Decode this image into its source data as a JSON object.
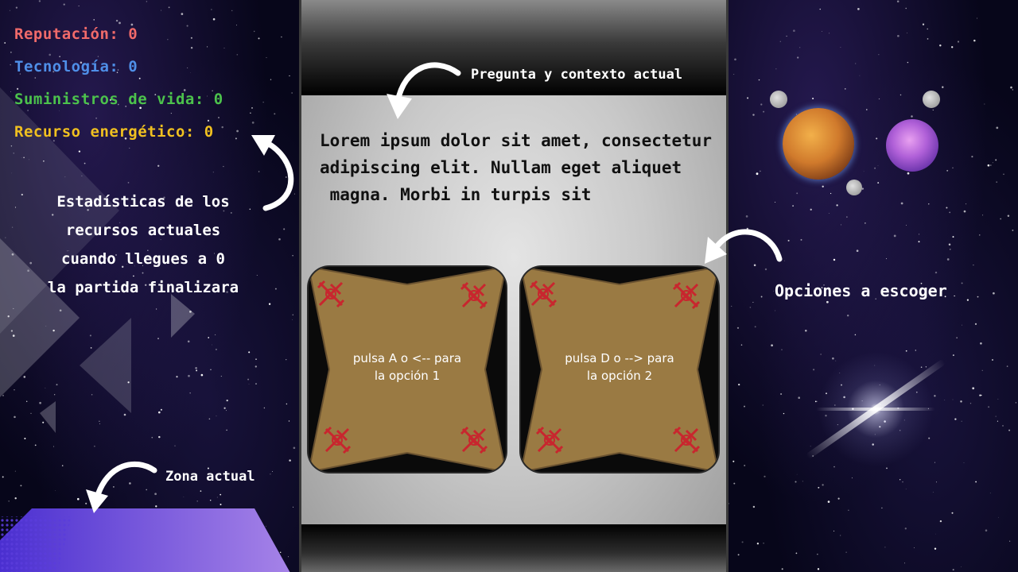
{
  "stats": {
    "reputation": {
      "label": "Reputación: 0",
      "color": "#f06a6a"
    },
    "technology": {
      "label": "Tecnología: 0",
      "color": "#4f8fe8"
    },
    "supplies": {
      "label": "Suministros de vida: 0",
      "color": "#4cc24c"
    },
    "energy": {
      "label": "Recurso energético: 0",
      "color": "#f0c020"
    }
  },
  "annotations": {
    "stats_note": [
      "Estadísticas de los",
      "recursos actuales",
      "cuando llegues a 0",
      "la partida finalizara"
    ],
    "question_note": "Pregunta y contexto actual",
    "options_note": "Opciones a escoger",
    "zone_note": "Zona actual"
  },
  "question": {
    "lines": [
      "Lorem ipsum dolor sit amet, consectetur",
      "adipiscing elit. Nullam eget aliquet",
      " magna. Morbi in turpis sit"
    ]
  },
  "options": [
    {
      "lines": [
        "pulsa A o <-- para",
        "la opción 1"
      ]
    },
    {
      "lines": [
        "pulsa D o --> para",
        "la opción 2"
      ]
    }
  ],
  "colors": {
    "card_fill": "#9a7a43",
    "card_ornament": "#c8262e",
    "zone_gradient_start": "#4a2fd0",
    "zone_gradient_end": "#a784e8"
  },
  "icons": {
    "arrow": "curved-arrow-icon",
    "ornament": "card-corner-ornament-icon"
  }
}
